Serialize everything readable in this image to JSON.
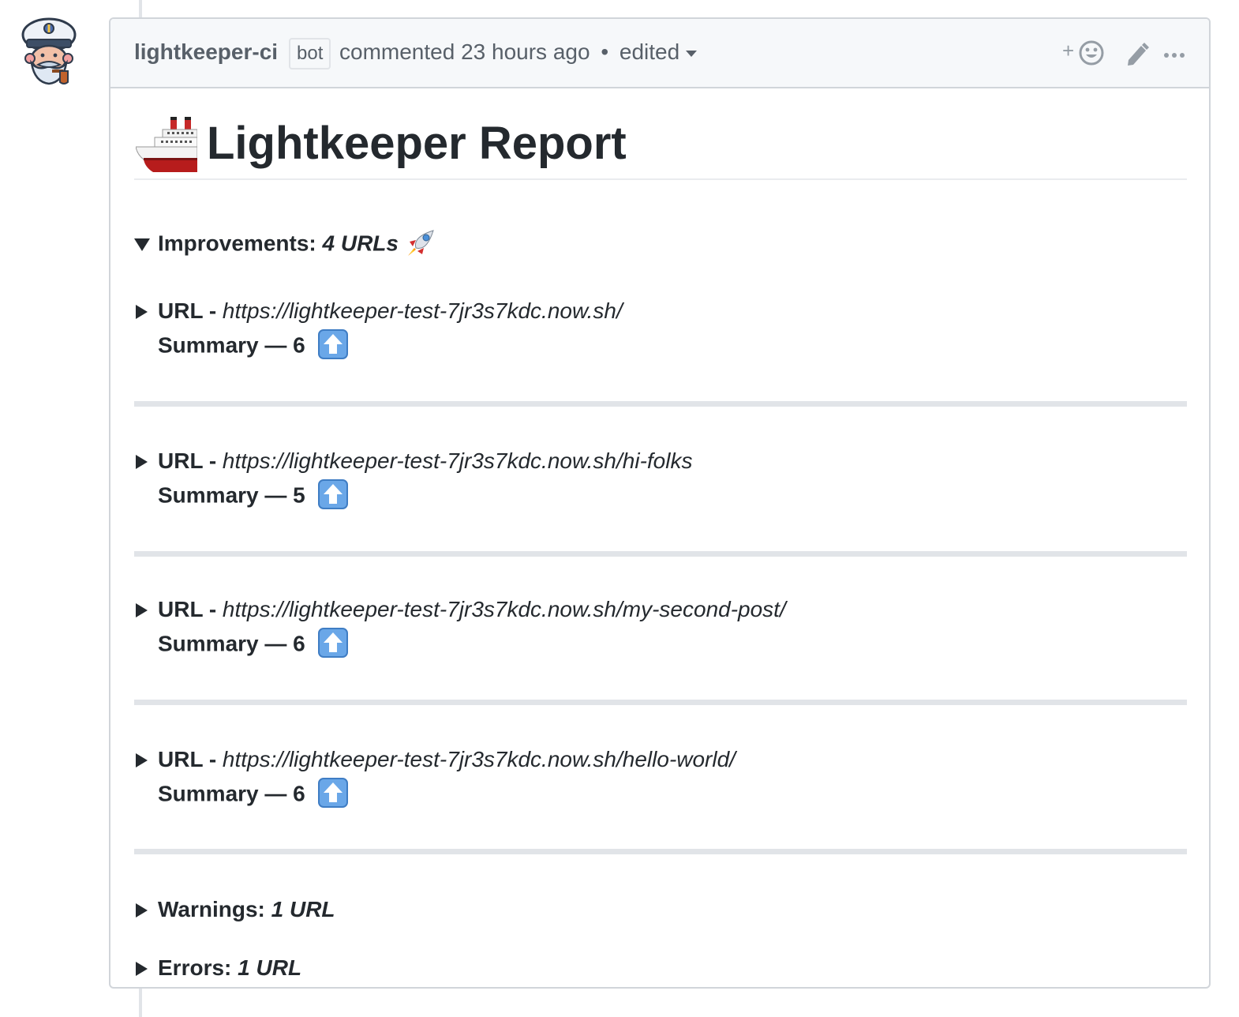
{
  "comment": {
    "author": "lightkeeper-ci",
    "author_label": "bot",
    "meta_text": "commented 23 hours ago",
    "dot": "•",
    "edited_label": "edited",
    "reaction_plus": "+",
    "icons": [
      "avatar",
      "smiley-icon",
      "pencil-icon",
      "kebab-icon"
    ]
  },
  "report": {
    "title": "Lightkeeper Report",
    "title_icon": "ship-icon",
    "improvements": {
      "label": "Improvements:",
      "count": "4 URLs",
      "icon": "rocket-icon",
      "items": [
        {
          "url_label": "URL - ",
          "url": "https://lightkeeper-test-7jr3s7kdc.now.sh/",
          "summary_label": "Summary — ",
          "summary_value": "6",
          "icon": "up-arrow-icon"
        },
        {
          "url_label": "URL - ",
          "url": "https://lightkeeper-test-7jr3s7kdc.now.sh/hi-folks",
          "summary_label": "Summary — ",
          "summary_value": "5",
          "icon": "up-arrow-icon"
        },
        {
          "url_label": "URL - ",
          "url": "https://lightkeeper-test-7jr3s7kdc.now.sh/my-second-post/",
          "summary_label": "Summary — ",
          "summary_value": "6",
          "icon": "up-arrow-icon"
        },
        {
          "url_label": "URL - ",
          "url": "https://lightkeeper-test-7jr3s7kdc.now.sh/hello-world/",
          "summary_label": "Summary — ",
          "summary_value": "6",
          "icon": "up-arrow-icon"
        }
      ]
    },
    "warnings": {
      "label": "Warnings: ",
      "count": "1 URL"
    },
    "errors": {
      "label": "Errors: ",
      "count": "1 URL"
    }
  },
  "colors": {
    "text": "#24292e",
    "muted": "#586069",
    "header_bg": "#f6f8fa",
    "border": "#d1d5da",
    "rule": "#e1e4e8",
    "emoji_blue": "#5b9bd5"
  }
}
